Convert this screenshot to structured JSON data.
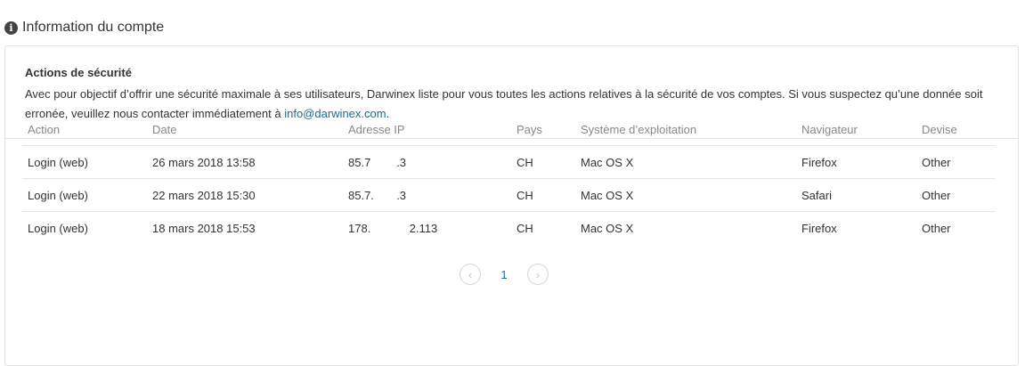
{
  "header": {
    "title": "Information du compte",
    "icon": "info-icon"
  },
  "security": {
    "title": "Actions de sécurité",
    "text": "Avec pour objectif d’offrir une sécurité maximale à ses utilisateurs, Darwinex liste pour vous toutes les actions relatives à la sécurité de vos comptes. Si vous suspectez qu’une donnée soit erronée, veuillez nous contacter immédiatement à ",
    "email": "info@darwinex.com",
    "text_end": "."
  },
  "table": {
    "columns": [
      "Action",
      "Date",
      "Adresse IP",
      "Pays",
      "Système d’exploitation",
      "Navigateur",
      "Devise"
    ],
    "rows": [
      [
        "Login (web)",
        "26 mars 2018 13:58",
        "85.7        .3",
        "CH",
        "Mac OS X",
        "Firefox",
        "Other"
      ],
      [
        "Login (web)",
        "22 mars 2018 15:30",
        "85.7.       .3",
        "CH",
        "Mac OS X",
        "Safari",
        "Other"
      ],
      [
        "Login (web)",
        "18 mars 2018 15:53",
        "178.            2.113",
        "CH",
        "Mac OS X",
        "Firefox",
        "Other"
      ]
    ]
  },
  "pagination": {
    "prev": "‹",
    "current": "1",
    "next": "›"
  }
}
